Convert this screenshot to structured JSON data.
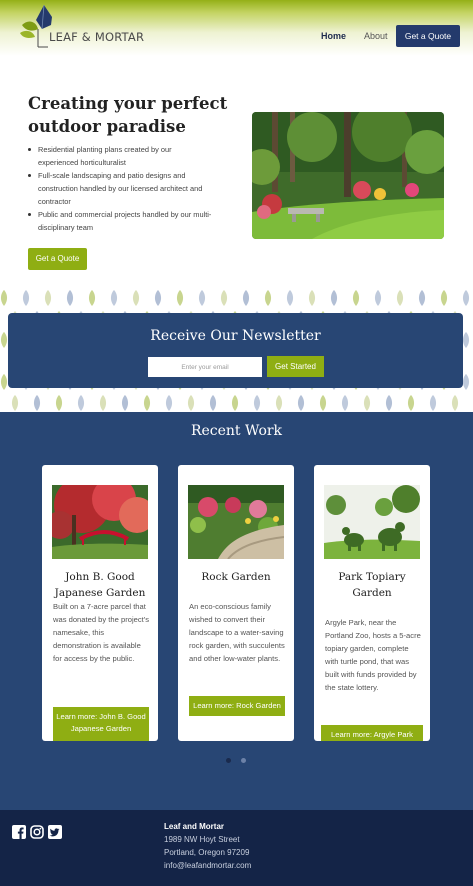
{
  "brand": {
    "name": "LEAF & MORTAR"
  },
  "nav": {
    "home": "Home",
    "about": "About",
    "quote": "Get a Quote"
  },
  "hero": {
    "title": "Creating your perfect outdoor paradise",
    "bullets": [
      "Residential planting plans created by our experienced horticulturalist",
      "Full-scale landscaping and patio designs and construction handled by our licensed architect and contractor",
      "Public and commercial projects handled by our multi-disciplinary team"
    ],
    "button": "Get a Quote"
  },
  "newsletter": {
    "title": "Receive Our Newsletter",
    "placeholder": "Enter your email",
    "button": "Get Started"
  },
  "recent": {
    "title": "Recent Work",
    "cards": [
      {
        "title": "John B. Good Japanese Garden",
        "desc": "Built on a 7-acre parcel that was donated by the project's namesake, this demonstration is available for access by the public.",
        "button": "Learn more: John B. Good Japanese Garden"
      },
      {
        "title": "Rock Garden",
        "desc": "An eco-conscious family wished to convert their landscape to a water-saving rock garden, with succulents and other low-water plants.",
        "button": "Learn more: Rock Garden"
      },
      {
        "title": "Park Topiary Garden",
        "desc": "Argyle Park, near the Portland Zoo, hosts a 5-acre topiary garden, complete with turtle pond, that was built with funds provided by the state lottery.",
        "button": "Learn more: Argyle Park"
      }
    ]
  },
  "carousel": {
    "pages": 2,
    "active": 1
  },
  "footer": {
    "name": "Leaf and Mortar",
    "street": "1989 NW Hoyt Street",
    "city": "Portland, Oregon 97209",
    "email": "info@leafandmortar.com",
    "social": [
      "facebook-icon",
      "instagram-icon",
      "twitter-icon"
    ]
  },
  "colors": {
    "navy": "#284674",
    "dark_navy": "#142447",
    "green": "#8fae13",
    "nav_button": "#243a6c"
  }
}
